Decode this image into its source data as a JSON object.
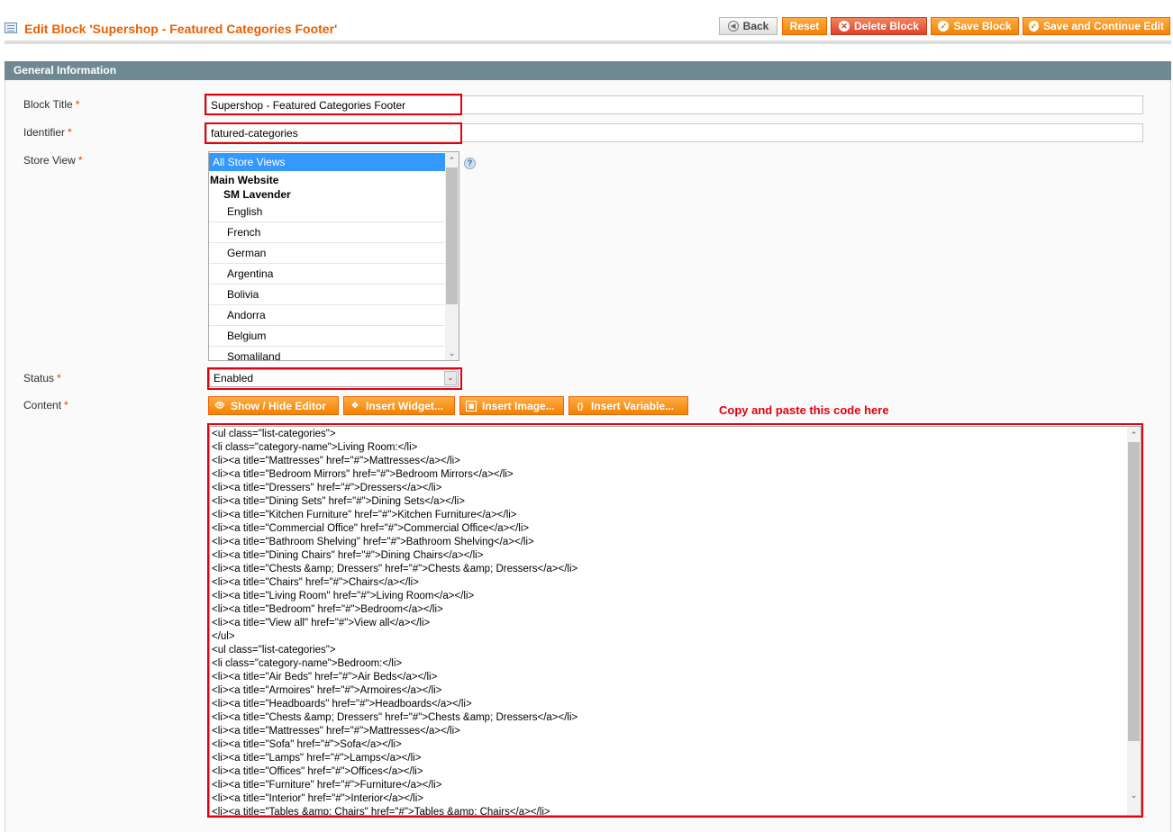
{
  "header": {
    "title": "Edit Block 'Supershop - Featured Categories Footer'",
    "icon": "block-grid-icon",
    "buttons": {
      "back": "Back",
      "reset": "Reset",
      "delete": "Delete Block",
      "save": "Save Block",
      "save_continue": "Save and Continue Edit"
    }
  },
  "section": {
    "title": "General Information"
  },
  "form": {
    "block_title": {
      "label": "Block Title",
      "required": "*",
      "value": "Supershop - Featured Categories Footer"
    },
    "identifier": {
      "label": "Identifier",
      "required": "*",
      "value": "fatured-categories"
    },
    "store_view": {
      "label": "Store View",
      "required": "*",
      "selected": "All Store Views",
      "group": "Main Website",
      "subgroup": "SM Lavender",
      "options": [
        "English",
        "French",
        "German",
        "Argentina",
        "Bolivia",
        "Andorra",
        "Belgium",
        "Somaliland"
      ]
    },
    "status": {
      "label": "Status",
      "required": "*",
      "value": "Enabled"
    },
    "content": {
      "label": "Content",
      "required": "*",
      "buttons": {
        "show_hide": "Show / Hide Editor",
        "widget": "Insert Widget...",
        "image": "Insert Image...",
        "variable": "Insert Variable..."
      },
      "annotation": "Copy and paste this code here",
      "lines": [
        "<ul class=\"list-categories\">",
        "<li class=\"category-name\">Living Room:</li>",
        "<li><a title=\"Mattresses\" href=\"#\">Mattresses</a></li>",
        "<li><a title=\"Bedroom Mirrors\" href=\"#\">Bedroom Mirrors</a></li>",
        "<li><a title=\"Dressers\" href=\"#\">Dressers</a></li>",
        "<li><a title=\"Dining Sets\" href=\"#\">Dining Sets</a></li>",
        "<li><a title=\"Kitchen Furniture\" href=\"#\">Kitchen Furniture</a></li>",
        "<li><a title=\"Commercial Office\" href=\"#\">Commercial Office</a></li>",
        "<li><a title=\"Bathroom Shelving\" href=\"#\">Bathroom Shelving</a></li>",
        "<li><a title=\"Dining Chairs\" href=\"#\">Dining Chairs</a></li>",
        "<li><a title=\"Chests &amp; Dressers\" href=\"#\">Chests &amp; Dressers</a></li>",
        "<li><a title=\"Chairs\" href=\"#\">Chairs</a></li>",
        "<li><a title=\"Living Room\" href=\"#\">Living Room</a></li>",
        "<li><a title=\"Bedroom\" href=\"#\">Bedroom</a></li>",
        "<li><a title=\"View all\" href=\"#\">View all</a></li>",
        "</ul>",
        "<ul class=\"list-categories\">",
        "<li class=\"category-name\">Bedroom:</li>",
        "<li><a title=\"Air Beds\" href=\"#\">Air Beds</a></li>",
        "<li><a title=\"Armoires\" href=\"#\">Armoires</a></li>",
        "<li><a title=\"Headboards\" href=\"#\">Headboards</a></li>",
        "<li><a title=\"Chests &amp; Dressers\" href=\"#\">Chests &amp; Dressers</a></li>",
        "<li><a title=\"Mattresses\" href=\"#\">Mattresses</a></li>",
        "<li><a title=\"Sofa\" href=\"#\">Sofa</a></li>",
        "<li><a title=\"Lamps\" href=\"#\">Lamps</a></li>",
        "<li><a title=\"Offices\" href=\"#\">Offices</a></li>",
        "<li><a title=\"Furniture\" href=\"#\">Furniture</a></li>",
        "<li><a title=\"Interior\" href=\"#\">Interior</a></li>",
        "<li><a title=\"Tables &amp; Chairs\" href=\"#\">Tables &amp; Chairs</a></li>"
      ]
    }
  },
  "colors": {
    "accent": "#eb5e00",
    "highlight": "#e3000f",
    "section_header": "#6f8992",
    "selection": "#3399ff"
  }
}
